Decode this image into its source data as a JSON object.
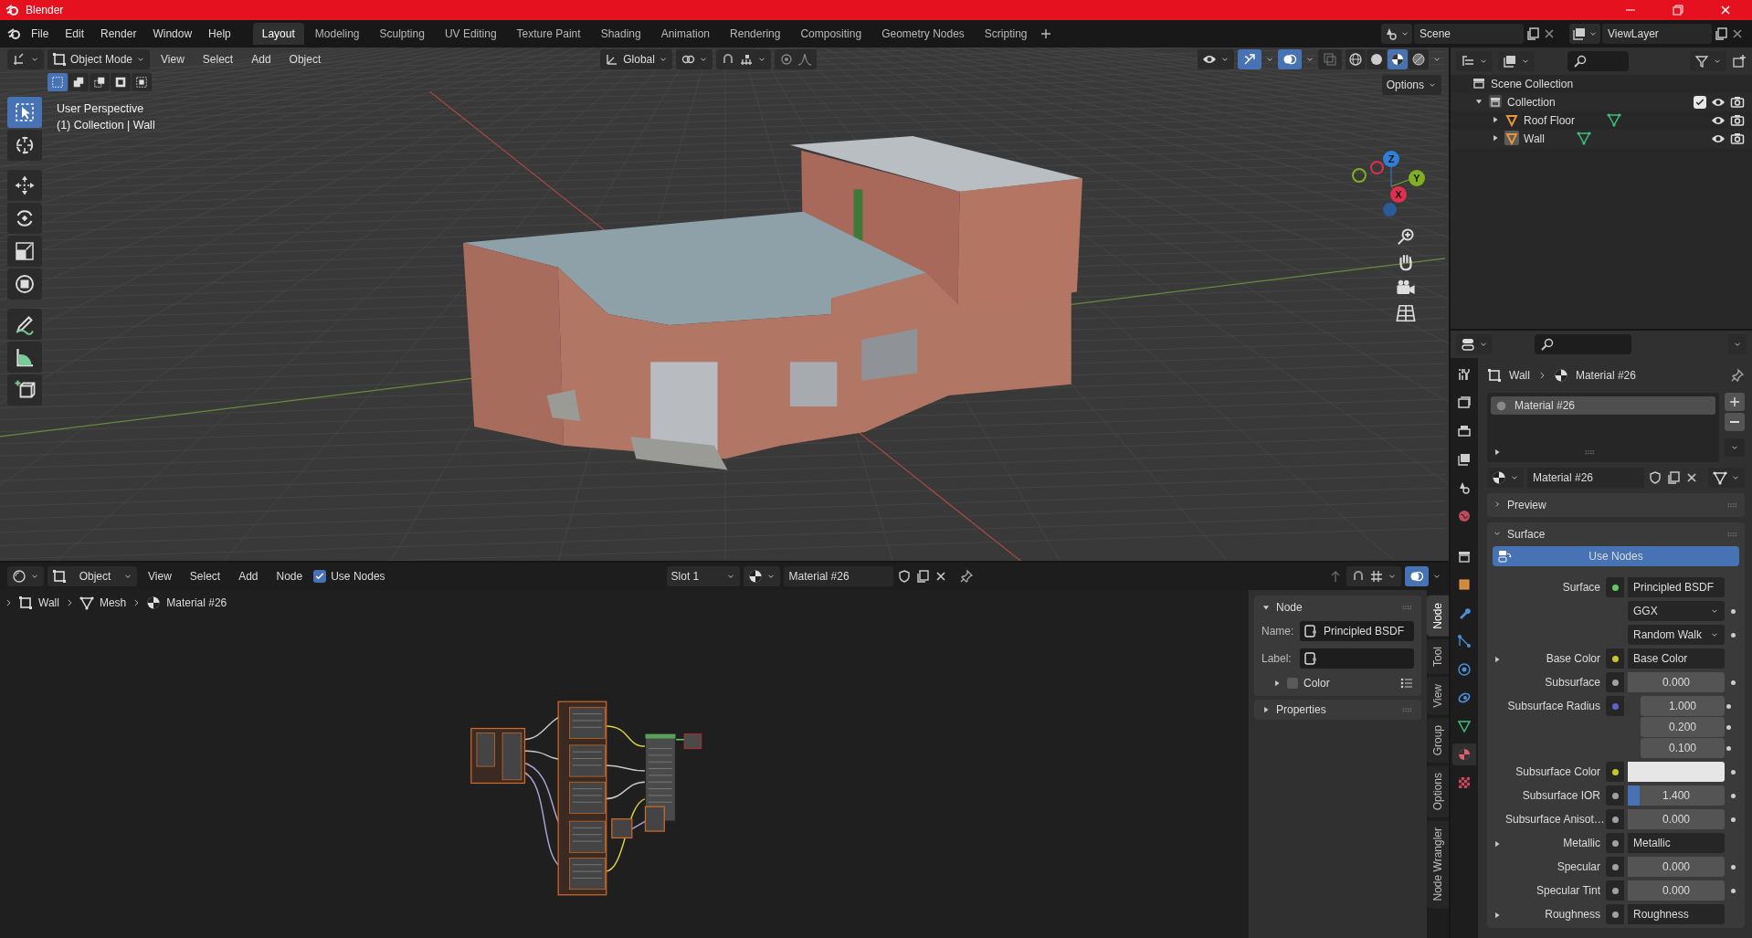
{
  "window": {
    "title": "Blender"
  },
  "menu": [
    "File",
    "Edit",
    "Render",
    "Window",
    "Help"
  ],
  "workspaces": [
    {
      "label": "Layout",
      "selected": true
    },
    {
      "label": "Modeling",
      "selected": false
    },
    {
      "label": "Sculpting",
      "selected": false
    },
    {
      "label": "UV Editing",
      "selected": false
    },
    {
      "label": "Texture Paint",
      "selected": false
    },
    {
      "label": "Shading",
      "selected": false
    },
    {
      "label": "Animation",
      "selected": false
    },
    {
      "label": "Rendering",
      "selected": false
    },
    {
      "label": "Compositing",
      "selected": false
    },
    {
      "label": "Geometry Nodes",
      "selected": false
    },
    {
      "label": "Scripting",
      "selected": false
    }
  ],
  "scene": {
    "name": "Scene"
  },
  "view_layer": {
    "name": "ViewLayer"
  },
  "viewport": {
    "mode": "Object Mode",
    "menus": [
      "View",
      "Select",
      "Add",
      "Object"
    ],
    "orientation": "Global",
    "options": "Options",
    "select_modes": [
      {
        "kind": "set",
        "selected": true
      },
      {
        "kind": "extend",
        "selected": false
      },
      {
        "kind": "subtract",
        "selected": false
      },
      {
        "kind": "invert",
        "selected": false
      },
      {
        "kind": "intersect",
        "selected": false
      }
    ],
    "shading": [
      {
        "kind": "wireframe",
        "selected": false
      },
      {
        "kind": "solid",
        "selected": false
      },
      {
        "kind": "material",
        "selected": true
      },
      {
        "kind": "rendered",
        "selected": false
      }
    ],
    "overlay": [
      "User Perspective",
      "(1) Collection | Wall"
    ],
    "axes": [
      {
        "label": "Z",
        "color": "#2f7fd8"
      },
      {
        "label": "Y",
        "color": "#80b020"
      },
      {
        "label": "X",
        "color": "#e03050"
      }
    ],
    "tools": [
      {
        "kind": "select",
        "selected": true
      },
      {
        "kind": "cursor",
        "selected": false
      },
      {
        "kind": "move",
        "selected": false
      },
      {
        "kind": "rotate",
        "selected": false
      },
      {
        "kind": "scale",
        "selected": false
      },
      {
        "kind": "transform",
        "selected": false
      },
      {
        "kind": "annotate",
        "selected": false
      },
      {
        "kind": "measure",
        "selected": false
      },
      {
        "kind": "add-cube",
        "selected": false
      }
    ]
  },
  "outliner": {
    "items": [
      {
        "label": "Scene Collection",
        "kind": "scene-collection",
        "children": [
          {
            "label": "Collection",
            "kind": "collection",
            "expanded": true,
            "checked": true,
            "children": [
              {
                "label": "Roof Floor",
                "kind": "mesh-object",
                "expanded": false,
                "selected": false
              },
              {
                "label": "Wall",
                "kind": "mesh-object",
                "expanded": false,
                "selected": true
              }
            ]
          }
        ]
      }
    ]
  },
  "node_editor": {
    "editor": "Object",
    "menus": [
      "View",
      "Select",
      "Add",
      "Node"
    ],
    "use_nodes": {
      "label": "Use Nodes",
      "checked": true
    },
    "slot": "Slot 1",
    "material": "Material #26",
    "breadcrumb": [
      {
        "label": "Wall",
        "kind": "object"
      },
      {
        "label": "Mesh",
        "kind": "mesh"
      },
      {
        "label": "Material #26",
        "kind": "material"
      }
    ],
    "sidebar": {
      "panel": "Node",
      "name_label": "Name:",
      "name": "Principled BSDF",
      "label_label": "Label:",
      "color_label": "Color",
      "color_checked": false,
      "properties": "Properties"
    },
    "tabs": [
      {
        "label": "Node",
        "selected": true
      },
      {
        "label": "Tool",
        "selected": false
      },
      {
        "label": "View",
        "selected": false
      },
      {
        "label": "Group",
        "selected": false
      },
      {
        "label": "Options",
        "selected": false
      },
      {
        "label": "Node Wrangler",
        "selected": false
      }
    ]
  },
  "properties": {
    "tabs": [
      {
        "kind": "tool",
        "selected": false
      },
      {
        "kind": "render",
        "selected": false
      },
      {
        "kind": "output",
        "selected": false
      },
      {
        "kind": "view-layer",
        "selected": false
      },
      {
        "kind": "scene",
        "selected": false
      },
      {
        "kind": "world",
        "selected": false
      },
      {
        "kind": "collection",
        "selected": false
      },
      {
        "kind": "object",
        "selected": false
      },
      {
        "kind": "modifiers",
        "selected": false
      },
      {
        "kind": "particles",
        "selected": false
      },
      {
        "kind": "physics",
        "selected": false
      },
      {
        "kind": "constraints",
        "selected": false
      },
      {
        "kind": "data",
        "selected": false
      },
      {
        "kind": "material",
        "selected": true
      },
      {
        "kind": "texture",
        "selected": false
      }
    ],
    "breadcrumb": [
      "Wall",
      "Material #26"
    ],
    "slots": [
      {
        "label": "Material #26",
        "selected": true
      }
    ],
    "material": "Material #26",
    "panels": [
      {
        "label": "Preview",
        "expanded": false
      },
      {
        "label": "Surface",
        "expanded": true
      }
    ],
    "use_nodes": "Use Nodes",
    "rows": [
      {
        "kind": "link",
        "label": "Surface",
        "value": "Principled BSDF",
        "socket": {
          "color": "#63c763"
        },
        "expandable": false
      },
      {
        "kind": "dropdown",
        "value": "GGX"
      },
      {
        "kind": "dropdown",
        "value": "Random Walk"
      },
      {
        "kind": "link",
        "label": "Base Color",
        "value": "Base Color",
        "socket": {
          "color": "#c7c729"
        },
        "expandable": true
      },
      {
        "kind": "number",
        "label": "Subsurface",
        "value": "0.000",
        "socket": {
          "color": "#a1a1a1"
        }
      },
      {
        "kind": "vector",
        "label": "Subsurface Radius",
        "values": [
          "1.000",
          "0.200",
          "0.100"
        ],
        "socket": {
          "color": "#6363c7"
        }
      },
      {
        "kind": "swatch",
        "label": "Subsurface Color",
        "swatch": {
          "color": "#e6e6e6"
        },
        "socket": {
          "color": "#c7c729"
        }
      },
      {
        "kind": "number",
        "label": "Subsurface IOR",
        "value": "1.400",
        "level": 0.12,
        "socket": {
          "color": "#a1a1a1"
        }
      },
      {
        "kind": "number",
        "label": "Subsurface Anisot…",
        "value": "0.000",
        "socket": {
          "color": "#a1a1a1"
        }
      },
      {
        "kind": "link",
        "label": "Metallic",
        "value": "Metallic",
        "socket": {
          "color": "#a1a1a1"
        },
        "expandable": true
      },
      {
        "kind": "number",
        "label": "Specular",
        "value": "0.000",
        "socket": {
          "color": "#a1a1a1"
        }
      },
      {
        "kind": "number",
        "label": "Specular Tint",
        "value": "0.000",
        "socket": {
          "color": "#a1a1a1"
        }
      },
      {
        "kind": "link",
        "label": "Roughness",
        "value": "Roughness",
        "socket": {
          "color": "#a1a1a1"
        },
        "expandable": true
      }
    ]
  }
}
